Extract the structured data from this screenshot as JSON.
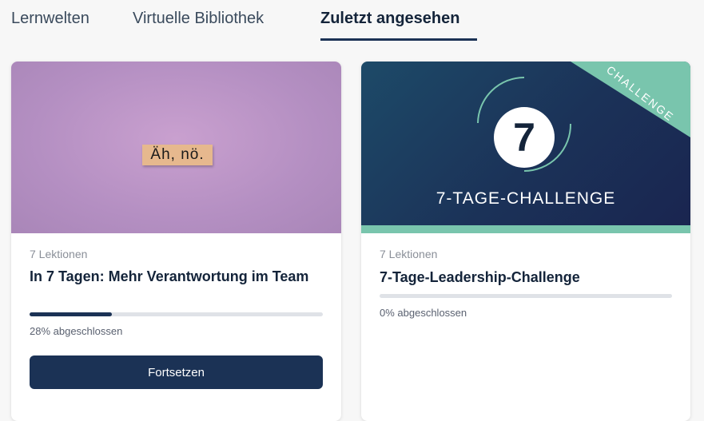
{
  "tabs": [
    {
      "label": "Lernwelten",
      "active": false
    },
    {
      "label": "Virtuelle Bibliothek",
      "active": false
    },
    {
      "label": "Zuletzt angesehen",
      "active": true
    }
  ],
  "cards": [
    {
      "lessons": "7 Lektionen",
      "title": "In 7 Tagen: Mehr Verantwortung im Team",
      "image_text": "Äh, nö.",
      "progress_percent": 28,
      "progress_label": "28% abgeschlossen",
      "button_label": "Fortsetzen"
    },
    {
      "lessons": "7 Lektionen",
      "title": "7-Tage-Leadership-Challenge",
      "badge_number": "7",
      "image_title": "7-TAGE-CHALLENGE",
      "corner_label": "CHALLENGE",
      "progress_percent": 0,
      "progress_label": "0% abgeschlossen"
    }
  ],
  "colors": {
    "primary": "#1b3255",
    "accent_teal": "#79c5ad",
    "thumb_pink": "#b48fc2"
  }
}
